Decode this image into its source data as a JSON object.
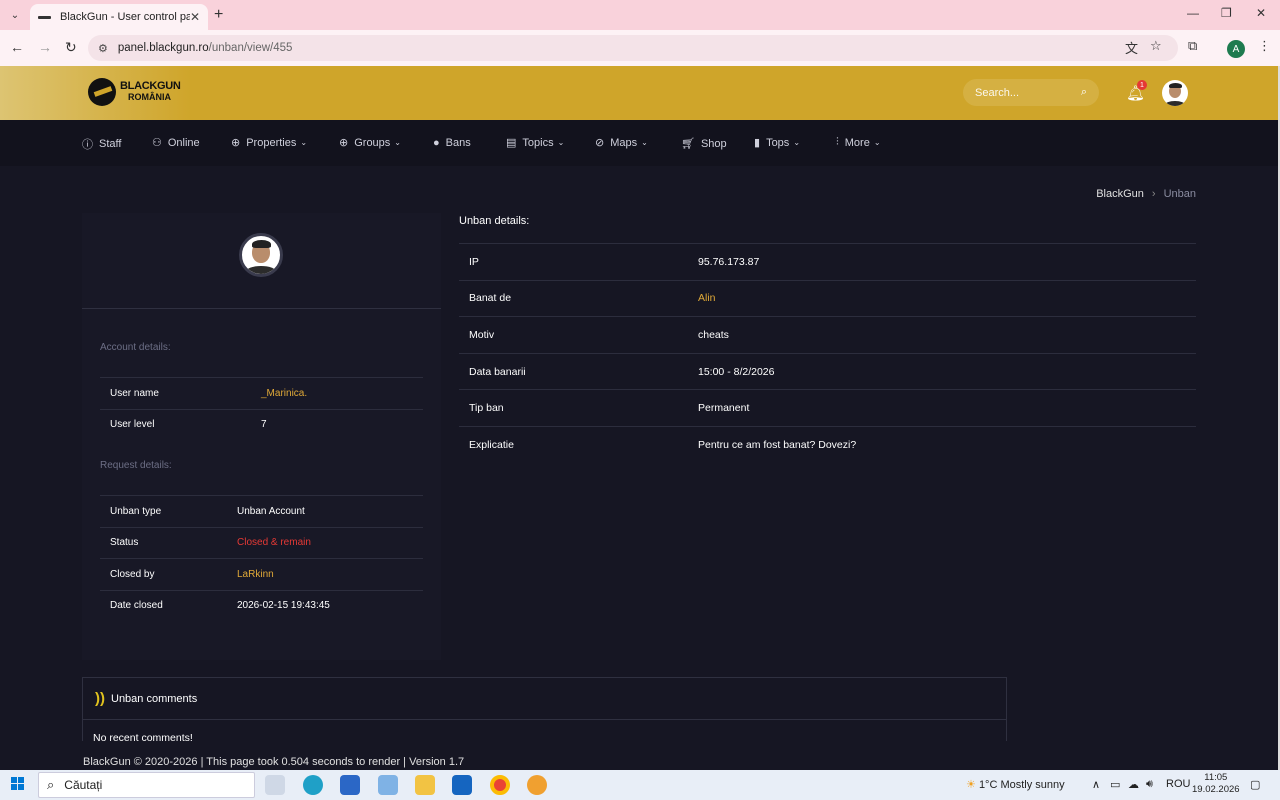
{
  "browser": {
    "tab_title": "BlackGun - User control panel",
    "url_domain": "panel.blackgun.ro",
    "url_path": "/unban/view/455",
    "profile_initial": "A"
  },
  "header": {
    "logo_line1": "BLACKGUN",
    "logo_line2": "ROMÂNIA",
    "search_placeholder": "Search...",
    "notification_count": "1"
  },
  "nav": {
    "items": [
      {
        "label": "Staff",
        "icon": "info-icon"
      },
      {
        "label": "Online",
        "icon": "users-icon"
      },
      {
        "label": "Properties",
        "icon": "globe-icon"
      },
      {
        "label": "Groups",
        "icon": "globe-icon"
      },
      {
        "label": "Bans",
        "icon": "globe-solid-icon"
      },
      {
        "label": "Topics",
        "icon": "document-icon"
      },
      {
        "label": "Maps",
        "icon": "compass-icon"
      },
      {
        "label": "Shop",
        "icon": "cart-icon"
      },
      {
        "label": "Tops",
        "icon": "bars-icon"
      },
      {
        "label": "More",
        "icon": "sliders-icon"
      }
    ]
  },
  "breadcrumb": {
    "home": "BlackGun",
    "current": "Unban"
  },
  "account": {
    "section_label": "Account details:",
    "rows": [
      {
        "key": "User name",
        "value": "_Marinica."
      },
      {
        "key": "User level",
        "value": "7"
      }
    ]
  },
  "request": {
    "section_label": "Request details:",
    "rows": [
      {
        "key": "Unban type",
        "value": "Unban Account"
      },
      {
        "key": "Status",
        "value": "Closed & remain"
      },
      {
        "key": "Closed by",
        "value": "LaRkinn"
      },
      {
        "key": "Date closed",
        "value": "2026-02-15 19:43:45"
      }
    ]
  },
  "unban": {
    "title": "Unban details:",
    "rows": [
      {
        "key": "IP",
        "value": "95.76.173.87"
      },
      {
        "key": "Banat de",
        "value": "Alin"
      },
      {
        "key": "Motiv",
        "value": "cheats"
      },
      {
        "key": "Data banarii",
        "value": "15:00 - 8/2/2026"
      },
      {
        "key": "Tip ban",
        "value": "Permanent"
      },
      {
        "key": "Explicatie",
        "value": "Pentru ce am fost banat? Dovezi?"
      }
    ]
  },
  "comments": {
    "title": "Unban comments",
    "empty_text": "No recent comments!"
  },
  "footer": "BlackGun © 2020-2026 | This page took 0.504 seconds to render | Version 1.7",
  "taskbar": {
    "search_placeholder": "Căutați",
    "weather": "1°C  Mostly sunny",
    "lang": "ROU",
    "time": "11:05",
    "date": "19.02.2026"
  },
  "colors": {
    "accent_gold": "#cfa52a",
    "link_gold": "#e0a938",
    "status_red": "#e53935",
    "bg_dark": "#161623"
  }
}
